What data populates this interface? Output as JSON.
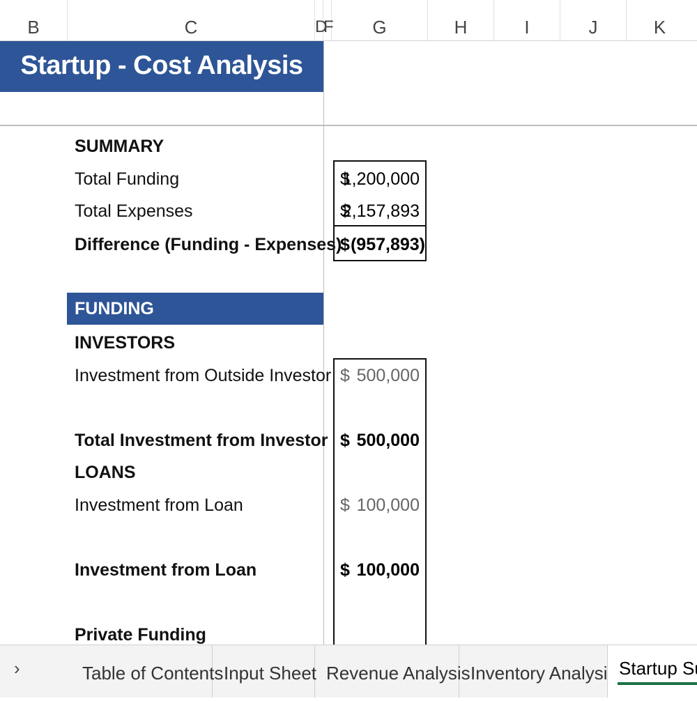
{
  "columns": [
    "B",
    "C",
    "D",
    "F",
    "G",
    "H",
    "I",
    "J",
    "K"
  ],
  "title": "Startup - Cost Analysis",
  "summary": {
    "heading": "SUMMARY",
    "rows": [
      {
        "label": "Total Funding",
        "currency": "$",
        "value": "1,200,000"
      },
      {
        "label": "Total Expenses",
        "currency": "$",
        "value": "2,157,893"
      },
      {
        "label": "Difference (Funding - Expenses)",
        "currency": "$",
        "value": "(957,893)"
      }
    ]
  },
  "funding": {
    "band": "FUNDING",
    "investors": {
      "heading": "INVESTORS",
      "item_label": "Investment from Outside Investor",
      "item_currency": "$",
      "item_value": "500,000",
      "total_label": "Total Investment from Investor",
      "total_currency": "$",
      "total_value": "500,000"
    },
    "loans": {
      "heading": "LOANS",
      "item_label": "Investment from Loan",
      "item_currency": "$",
      "item_value": "100,000",
      "total_label": "Investment from Loan",
      "total_currency": "$",
      "total_value": "100,000"
    },
    "private_heading": "Private Funding"
  },
  "tabs": {
    "scroll_icon": "›",
    "items": [
      "Table of Contents",
      "Input Sheet",
      "Revenue Analysis",
      "Inventory Analysis",
      "Startup Sum"
    ],
    "active_index": 4
  },
  "colors": {
    "title_band": "#2e5597",
    "active_tab_underline": "#1e7145"
  }
}
